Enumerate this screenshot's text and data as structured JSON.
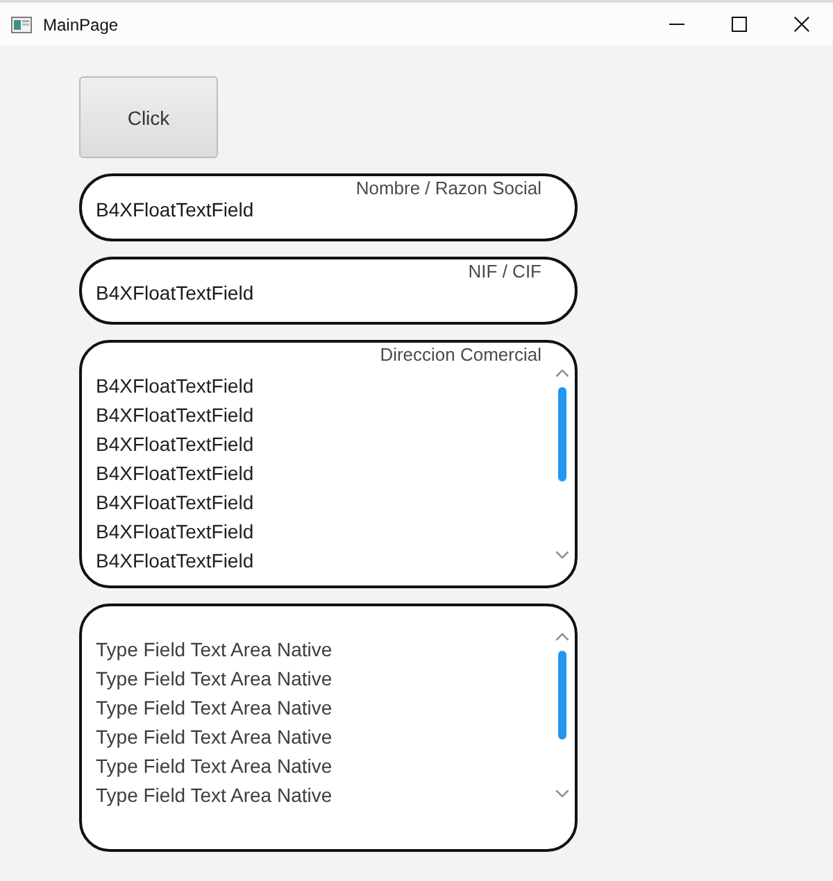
{
  "window": {
    "title": "MainPage"
  },
  "button": {
    "label": "Click"
  },
  "fields": [
    {
      "kind": "text",
      "label": "Nombre / Razon Social",
      "value": "B4XFloatTextField"
    },
    {
      "kind": "text",
      "label": "NIF / CIF",
      "value": "B4XFloatTextField"
    },
    {
      "kind": "area",
      "label": "Direccion Comercial",
      "lines": [
        "B4XFloatTextField",
        "B4XFloatTextField",
        "B4XFloatTextField",
        "B4XFloatTextField",
        "B4XFloatTextField",
        "B4XFloatTextField",
        "B4XFloatTextField"
      ]
    },
    {
      "kind": "area",
      "lines": [
        "Type Field Text Area Native",
        "Type Field Text Area Native",
        "Type Field Text Area Native",
        "Type Field Text Area Native",
        "Type Field Text Area Native",
        "Type Field Text Area Native"
      ]
    }
  ]
}
